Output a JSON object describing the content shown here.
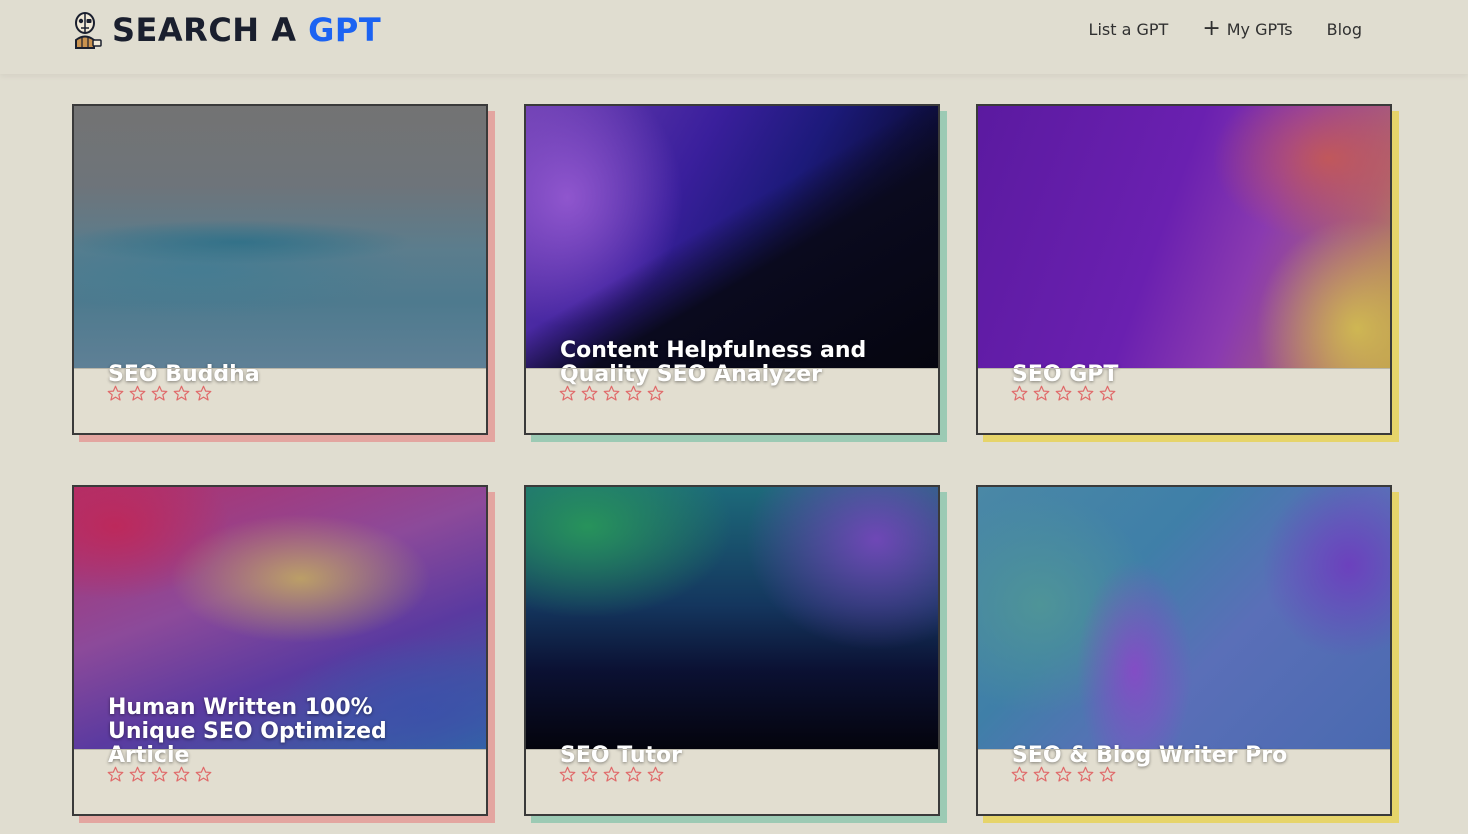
{
  "header": {
    "brand_prefix": "SEARCH A ",
    "brand_accent": "GPT",
    "nav": [
      {
        "label": "List a GPT",
        "icon": ""
      },
      {
        "label": "My GPTs",
        "icon": "plus-icon"
      },
      {
        "label": "Blog",
        "icon": ""
      }
    ]
  },
  "colors": {
    "background": "#e0ddd0",
    "brand_accent": "#1c63f2",
    "star": "#e06a6a",
    "card_shadows": [
      "#e3a5a0",
      "#9ccab4",
      "#e6d46a"
    ]
  },
  "cards": [
    {
      "title": "SEO Buddha",
      "rating": 0,
      "max_rating": 5,
      "shadow": "#e3a5a0"
    },
    {
      "title": "Content Helpfulness and Quality SEO Analyzer",
      "rating": 0,
      "max_rating": 5,
      "shadow": "#9ccab4"
    },
    {
      "title": "SEO GPT",
      "rating": 0,
      "max_rating": 5,
      "shadow": "#e6d46a"
    },
    {
      "title": "Human Written 100% Unique SEO Optimized Article",
      "rating": 0,
      "max_rating": 5,
      "shadow": "#e3a5a0"
    },
    {
      "title": "SEO Tutor",
      "rating": 0,
      "max_rating": 5,
      "shadow": "#9ccab4"
    },
    {
      "title": "SEO & Blog Writer Pro",
      "rating": 0,
      "max_rating": 5,
      "shadow": "#e6d46a"
    }
  ]
}
